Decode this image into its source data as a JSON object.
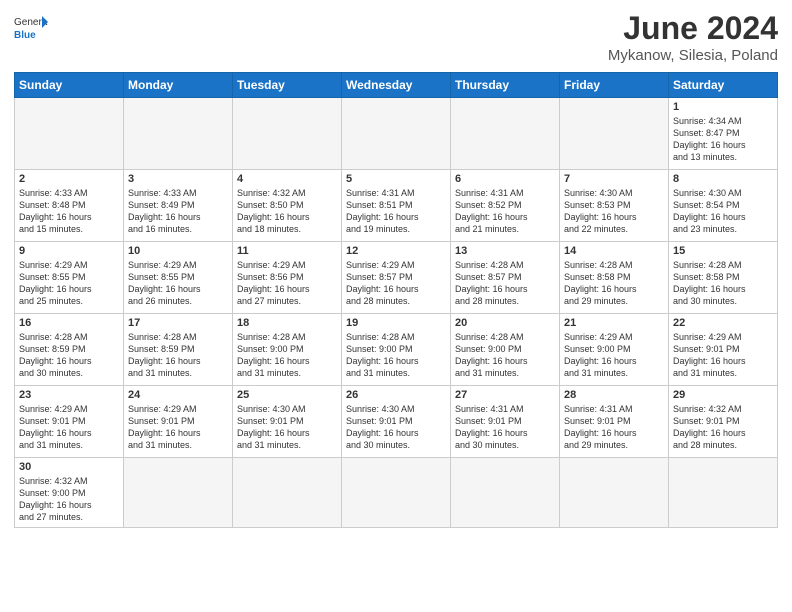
{
  "header": {
    "logo_general": "General",
    "logo_blue": "Blue",
    "title": "June 2024",
    "subtitle": "Mykanow, Silesia, Poland"
  },
  "days_of_week": [
    "Sunday",
    "Monday",
    "Tuesday",
    "Wednesday",
    "Thursday",
    "Friday",
    "Saturday"
  ],
  "weeks": [
    [
      {
        "day": "",
        "info": ""
      },
      {
        "day": "",
        "info": ""
      },
      {
        "day": "",
        "info": ""
      },
      {
        "day": "",
        "info": ""
      },
      {
        "day": "",
        "info": ""
      },
      {
        "day": "",
        "info": ""
      },
      {
        "day": "1",
        "info": "Sunrise: 4:34 AM\nSunset: 8:47 PM\nDaylight: 16 hours\nand 13 minutes."
      }
    ],
    [
      {
        "day": "2",
        "info": "Sunrise: 4:33 AM\nSunset: 8:48 PM\nDaylight: 16 hours\nand 15 minutes."
      },
      {
        "day": "3",
        "info": "Sunrise: 4:33 AM\nSunset: 8:49 PM\nDaylight: 16 hours\nand 16 minutes."
      },
      {
        "day": "4",
        "info": "Sunrise: 4:32 AM\nSunset: 8:50 PM\nDaylight: 16 hours\nand 18 minutes."
      },
      {
        "day": "5",
        "info": "Sunrise: 4:31 AM\nSunset: 8:51 PM\nDaylight: 16 hours\nand 19 minutes."
      },
      {
        "day": "6",
        "info": "Sunrise: 4:31 AM\nSunset: 8:52 PM\nDaylight: 16 hours\nand 21 minutes."
      },
      {
        "day": "7",
        "info": "Sunrise: 4:30 AM\nSunset: 8:53 PM\nDaylight: 16 hours\nand 22 minutes."
      },
      {
        "day": "8",
        "info": "Sunrise: 4:30 AM\nSunset: 8:54 PM\nDaylight: 16 hours\nand 23 minutes."
      }
    ],
    [
      {
        "day": "9",
        "info": "Sunrise: 4:29 AM\nSunset: 8:55 PM\nDaylight: 16 hours\nand 25 minutes."
      },
      {
        "day": "10",
        "info": "Sunrise: 4:29 AM\nSunset: 8:55 PM\nDaylight: 16 hours\nand 26 minutes."
      },
      {
        "day": "11",
        "info": "Sunrise: 4:29 AM\nSunset: 8:56 PM\nDaylight: 16 hours\nand 27 minutes."
      },
      {
        "day": "12",
        "info": "Sunrise: 4:29 AM\nSunset: 8:57 PM\nDaylight: 16 hours\nand 28 minutes."
      },
      {
        "day": "13",
        "info": "Sunrise: 4:28 AM\nSunset: 8:57 PM\nDaylight: 16 hours\nand 28 minutes."
      },
      {
        "day": "14",
        "info": "Sunrise: 4:28 AM\nSunset: 8:58 PM\nDaylight: 16 hours\nand 29 minutes."
      },
      {
        "day": "15",
        "info": "Sunrise: 4:28 AM\nSunset: 8:58 PM\nDaylight: 16 hours\nand 30 minutes."
      }
    ],
    [
      {
        "day": "16",
        "info": "Sunrise: 4:28 AM\nSunset: 8:59 PM\nDaylight: 16 hours\nand 30 minutes."
      },
      {
        "day": "17",
        "info": "Sunrise: 4:28 AM\nSunset: 8:59 PM\nDaylight: 16 hours\nand 31 minutes."
      },
      {
        "day": "18",
        "info": "Sunrise: 4:28 AM\nSunset: 9:00 PM\nDaylight: 16 hours\nand 31 minutes."
      },
      {
        "day": "19",
        "info": "Sunrise: 4:28 AM\nSunset: 9:00 PM\nDaylight: 16 hours\nand 31 minutes."
      },
      {
        "day": "20",
        "info": "Sunrise: 4:28 AM\nSunset: 9:00 PM\nDaylight: 16 hours\nand 31 minutes."
      },
      {
        "day": "21",
        "info": "Sunrise: 4:29 AM\nSunset: 9:00 PM\nDaylight: 16 hours\nand 31 minutes."
      },
      {
        "day": "22",
        "info": "Sunrise: 4:29 AM\nSunset: 9:01 PM\nDaylight: 16 hours\nand 31 minutes."
      }
    ],
    [
      {
        "day": "23",
        "info": "Sunrise: 4:29 AM\nSunset: 9:01 PM\nDaylight: 16 hours\nand 31 minutes."
      },
      {
        "day": "24",
        "info": "Sunrise: 4:29 AM\nSunset: 9:01 PM\nDaylight: 16 hours\nand 31 minutes."
      },
      {
        "day": "25",
        "info": "Sunrise: 4:30 AM\nSunset: 9:01 PM\nDaylight: 16 hours\nand 31 minutes."
      },
      {
        "day": "26",
        "info": "Sunrise: 4:30 AM\nSunset: 9:01 PM\nDaylight: 16 hours\nand 30 minutes."
      },
      {
        "day": "27",
        "info": "Sunrise: 4:31 AM\nSunset: 9:01 PM\nDaylight: 16 hours\nand 30 minutes."
      },
      {
        "day": "28",
        "info": "Sunrise: 4:31 AM\nSunset: 9:01 PM\nDaylight: 16 hours\nand 29 minutes."
      },
      {
        "day": "29",
        "info": "Sunrise: 4:32 AM\nSunset: 9:01 PM\nDaylight: 16 hours\nand 28 minutes."
      }
    ],
    [
      {
        "day": "30",
        "info": "Sunrise: 4:32 AM\nSunset: 9:00 PM\nDaylight: 16 hours\nand 27 minutes."
      },
      {
        "day": "",
        "info": ""
      },
      {
        "day": "",
        "info": ""
      },
      {
        "day": "",
        "info": ""
      },
      {
        "day": "",
        "info": ""
      },
      {
        "day": "",
        "info": ""
      },
      {
        "day": "",
        "info": ""
      }
    ]
  ]
}
